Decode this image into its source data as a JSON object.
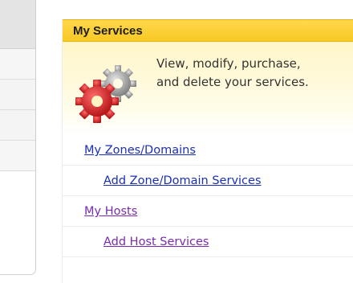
{
  "services": {
    "title": "My Services",
    "intro_line1": "View, modify, purchase,",
    "intro_line2": "and delete your services.",
    "icon": "gears-icon"
  },
  "links": [
    {
      "label": "My Zones/Domains",
      "level": 1,
      "visited": false
    },
    {
      "label": "Add Zone/Domain Services",
      "level": 2,
      "visited": false
    },
    {
      "label": "My Hosts",
      "level": 1,
      "visited": true
    },
    {
      "label": "Add Host Services",
      "level": 2,
      "visited": true
    }
  ],
  "colors": {
    "header": "#f7c825",
    "link": "#1a2fb8",
    "visited_link": "#7a2ab0"
  }
}
